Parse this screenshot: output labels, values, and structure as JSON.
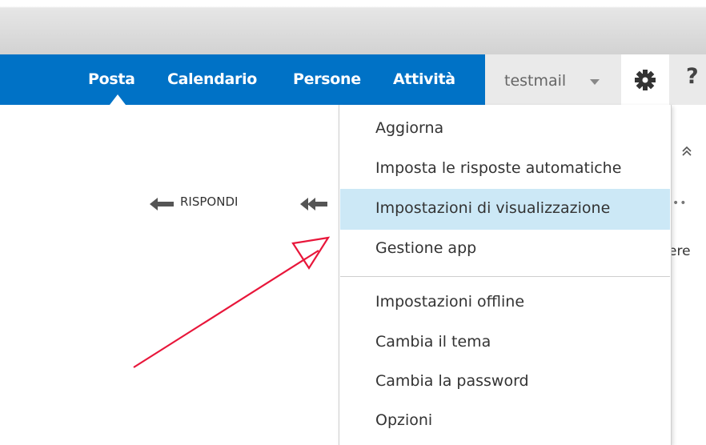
{
  "nav": {
    "items": [
      {
        "label": "Posta"
      },
      {
        "label": "Calendario"
      },
      {
        "label": "Persone"
      },
      {
        "label": "Attività"
      }
    ],
    "user": "testmail",
    "help": "?"
  },
  "toolbar": {
    "reply_label": "RISPONDI"
  },
  "side": {
    "more": "••",
    "partial_text": "ere"
  },
  "menu": {
    "items": [
      {
        "label": "Aggiorna"
      },
      {
        "label": "Imposta le risposte automatiche"
      },
      {
        "label": "Impostazioni di visualizzazione"
      },
      {
        "label": "Gestione app"
      },
      {
        "label": "Impostazioni offline"
      },
      {
        "label": "Cambia il tema"
      },
      {
        "label": "Cambia la password"
      },
      {
        "label": "Opzioni"
      }
    ],
    "selected_label": "Impostazioni di visualizzazione"
  },
  "colors": {
    "nav_bar": "#0072c6",
    "selected_item": "#cce8f6",
    "annotation_arrow": "#e8163a"
  },
  "icons": [
    "gear-icon",
    "reply-arrow-icon",
    "reply-all-icon",
    "collapse-up-icon",
    "dropdown-caret-icon"
  ]
}
